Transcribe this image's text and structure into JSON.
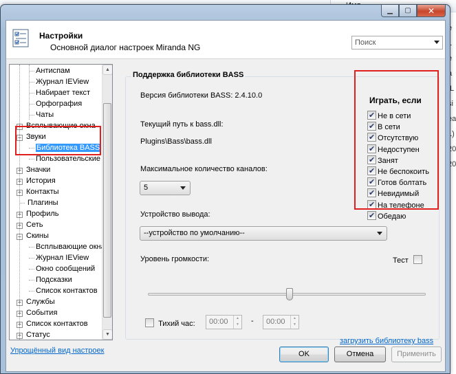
{
  "background": {
    "column_header": "Имя",
    "right_chars": [
      "e",
      "1",
      "e",
      "a",
      "[L",
      "si",
      "ea",
      "1)",
      "20",
      "20"
    ]
  },
  "window": {
    "title": "Настройки",
    "subtitle": "Основной диалог настроек Miranda NG"
  },
  "search": {
    "placeholder": "Поиск"
  },
  "tree": {
    "items": [
      {
        "label": "Антиспам",
        "level": 2,
        "expander": ""
      },
      {
        "label": "Журнал IEView",
        "level": 2,
        "expander": ""
      },
      {
        "label": "Набирает текст",
        "level": 2,
        "expander": ""
      },
      {
        "label": "Орфография",
        "level": 2,
        "expander": ""
      },
      {
        "label": "Чаты",
        "level": 2,
        "expander": ""
      },
      {
        "label": "Всплывающие окна",
        "level": 1,
        "expander": "+"
      },
      {
        "label": "Звуки",
        "level": 1,
        "expander": "−"
      },
      {
        "label": "Библиотека BASS",
        "level": 2,
        "expander": "",
        "selected": true
      },
      {
        "label": "Пользовательские",
        "level": 2,
        "expander": ""
      },
      {
        "label": "Значки",
        "level": 1,
        "expander": "+"
      },
      {
        "label": "История",
        "level": 1,
        "expander": "+"
      },
      {
        "label": "Контакты",
        "level": 1,
        "expander": "+"
      },
      {
        "label": "Плагины",
        "level": 1,
        "expander": ""
      },
      {
        "label": "Профиль",
        "level": 1,
        "expander": "+"
      },
      {
        "label": "Сеть",
        "level": 1,
        "expander": "+"
      },
      {
        "label": "Скины",
        "level": 1,
        "expander": "−"
      },
      {
        "label": "Всплывающие окна",
        "level": 2,
        "expander": ""
      },
      {
        "label": "Журнал IEView",
        "level": 2,
        "expander": ""
      },
      {
        "label": "Окно сообщений",
        "level": 2,
        "expander": ""
      },
      {
        "label": "Подсказки",
        "level": 2,
        "expander": ""
      },
      {
        "label": "Список контактов",
        "level": 2,
        "expander": ""
      },
      {
        "label": "Службы",
        "level": 1,
        "expander": "+"
      },
      {
        "label": "События",
        "level": 1,
        "expander": "+"
      },
      {
        "label": "Список контактов",
        "level": 1,
        "expander": "+"
      },
      {
        "label": "Статус",
        "level": 1,
        "expander": "+"
      }
    ]
  },
  "simple_view_link": "Упрощённый вид настроек",
  "bass": {
    "group_title": "Поддержка библиотеки BASS",
    "version_label": "Версия библиотеки BASS: 2.4.10.0",
    "path_label": "Текущий путь к bass.dll:",
    "path_value": "Plugins\\Bass\\bass.dll",
    "channels_label": "Максимальное количество каналов:",
    "channels_value": "5",
    "device_label": "Устройство вывода:",
    "device_value": "--устройство по умолчанию--",
    "volume_label": "Уровень громкости:",
    "volume_level_percent": 51,
    "test_label": "Тест",
    "quiet_label": "Тихий час:",
    "quiet_from": "00:00",
    "dash": "-",
    "quiet_to": "00:00",
    "load_link": "загрузить библиотеку bass"
  },
  "play_if": {
    "title": "Играть, если",
    "items": [
      {
        "label": "Не в сети",
        "checked": true
      },
      {
        "label": "В сети",
        "checked": true
      },
      {
        "label": "Отсутствую",
        "checked": true
      },
      {
        "label": "Недоступен",
        "checked": true
      },
      {
        "label": "Занят",
        "checked": true
      },
      {
        "label": "Не беспокоить",
        "checked": true
      },
      {
        "label": "Готов болтать",
        "checked": true
      },
      {
        "label": "Невидимый",
        "checked": true
      },
      {
        "label": "На телефоне",
        "checked": true
      },
      {
        "label": "Обедаю",
        "checked": true
      }
    ]
  },
  "buttons": {
    "ok": "OK",
    "cancel": "Отмена",
    "apply": "Применить"
  },
  "colors": {
    "highlight_red": "#e01e1e",
    "selection_blue": "#3399ff",
    "link_blue": "#0066cc"
  }
}
